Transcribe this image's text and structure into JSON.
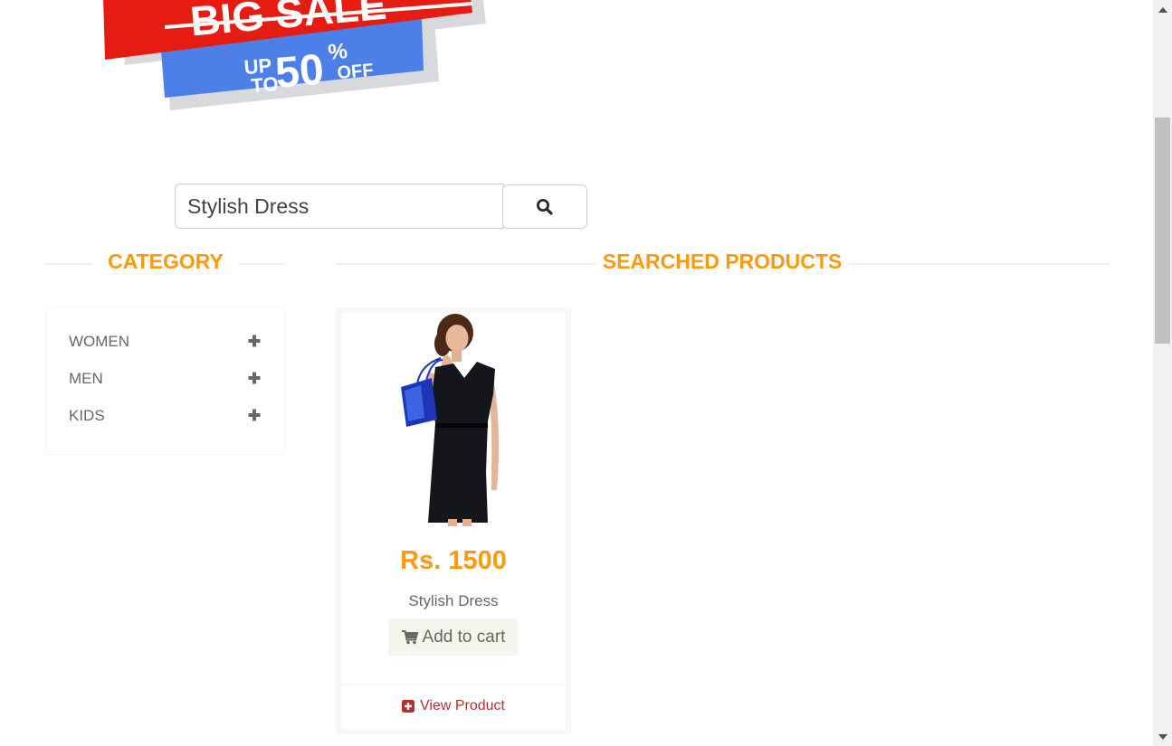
{
  "banner": {
    "headline": "BIG SALE",
    "line_up": "UP",
    "line_to": "TO",
    "percent": "50",
    "percent_sign": "%",
    "off": "OFF"
  },
  "search": {
    "value": "Stylish Dress",
    "button_icon": "search-icon"
  },
  "category": {
    "title": "Category",
    "items": [
      {
        "label": "Women",
        "toggle_icon": "plus-icon"
      },
      {
        "label": "Men",
        "toggle_icon": "plus-icon"
      },
      {
        "label": "Kids",
        "toggle_icon": "plus-icon"
      }
    ]
  },
  "results": {
    "title": "Searched Products",
    "products": [
      {
        "price": "Rs. 1500",
        "name": "Stylish Dress",
        "add_to_cart_label": "Add to cart",
        "view_label": "View Product"
      }
    ]
  },
  "colors": {
    "accent": "#FE980F",
    "text": "#696763",
    "link": "#B52F2F",
    "banner_red": "#E61C12",
    "banner_blue": "#4C7FE8"
  }
}
